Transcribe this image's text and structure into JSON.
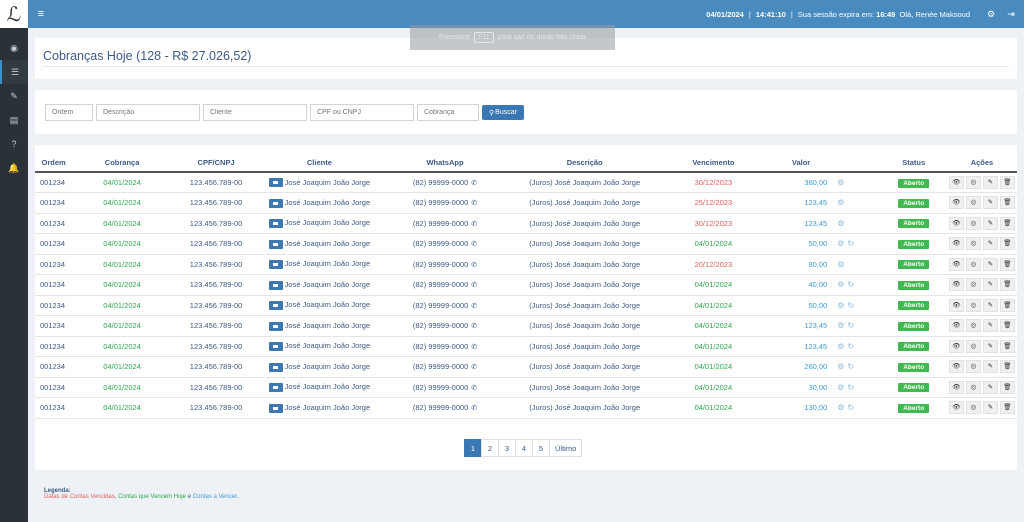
{
  "app": {
    "logo": "ℒ"
  },
  "sidebar": {
    "items": [
      {
        "name": "dashboard-icon",
        "glyph": "◉",
        "active": false
      },
      {
        "name": "list-icon",
        "glyph": "☰",
        "active": true
      },
      {
        "name": "edit-icon",
        "glyph": "✎",
        "active": false
      },
      {
        "name": "document-icon",
        "glyph": "▤",
        "active": false
      },
      {
        "name": "help-icon",
        "glyph": "?",
        "active": false
      },
      {
        "name": "bell-icon",
        "glyph": "🔔",
        "active": false
      }
    ]
  },
  "topbar": {
    "menu_glyph": "≡",
    "date": "04/01/2024",
    "divider": "|",
    "time": "14:41:10",
    "session_text": "Sua sessão expira em:",
    "session_time": "16:49",
    "greeting": "Olá, Renée Maksoud",
    "settings_glyph": "⚙",
    "logout_glyph": "⇥"
  },
  "fullscreen_toast": {
    "before": "Pressione",
    "key": "F11",
    "after": "para sair do modo tela cheia"
  },
  "page": {
    "title": "Cobranças Hoje (128 - R$ 27.026,52)"
  },
  "filters": {
    "ordem": "Ordem",
    "descricao": "Descrição",
    "cliente": "Cliente",
    "cpf": "CPF ou CNPJ",
    "cobranca": "Cobrança",
    "search_label": "Buscar"
  },
  "table": {
    "headers": [
      "Ordem",
      "Cobrança",
      "CPF/CNPJ",
      "Cliente",
      "WhatsApp",
      "Descrição",
      "Vencimento",
      "Valor",
      "",
      "Status",
      "Ações"
    ],
    "rows": [
      {
        "ordem": "001234",
        "cobranca": "04/01/2024",
        "cpf": "123.456.789-00",
        "cliente": "José Joaquim João Jorge",
        "whatsapp": "(82) 99999-0000",
        "descricao": "(Juros) José Joaquim João Jorge",
        "vencimento": "30/12/2023",
        "late": true,
        "valor": "380,00",
        "recurring": false,
        "status": "Aberto"
      },
      {
        "ordem": "001234",
        "cobranca": "04/01/2024",
        "cpf": "123.456.789-00",
        "cliente": "José Joaquim João Jorge",
        "whatsapp": "(82) 99999-0000",
        "descricao": "(Juros) José Joaquim João Jorge",
        "vencimento": "25/12/2023",
        "late": true,
        "valor": "123,45",
        "recurring": false,
        "status": "Aberto"
      },
      {
        "ordem": "001234",
        "cobranca": "04/01/2024",
        "cpf": "123.456.789-00",
        "cliente": "José Joaquim João Jorge",
        "whatsapp": "(82) 99999-0000",
        "descricao": "(Juros) José Joaquim João Jorge",
        "vencimento": "30/12/2023",
        "late": true,
        "valor": "123,45",
        "recurring": false,
        "status": "Aberto"
      },
      {
        "ordem": "001234",
        "cobranca": "04/01/2024",
        "cpf": "123.456.789-00",
        "cliente": "José Joaquim João Jorge",
        "whatsapp": "(82) 99999-0000",
        "descricao": "(Juros) José Joaquim João Jorge",
        "vencimento": "04/01/2024",
        "late": false,
        "valor": "50,00",
        "recurring": true,
        "status": "Aberto"
      },
      {
        "ordem": "001234",
        "cobranca": "04/01/2024",
        "cpf": "123.456.789-00",
        "cliente": "José Joaquim João Jorge",
        "whatsapp": "(82) 99999-0000",
        "descricao": "(Juros) José Joaquim João Jorge",
        "vencimento": "20/12/2023",
        "late": true,
        "valor": "80,00",
        "recurring": false,
        "status": "Aberto"
      },
      {
        "ordem": "001234",
        "cobranca": "04/01/2024",
        "cpf": "123.456.789-00",
        "cliente": "José Joaquim João Jorge",
        "whatsapp": "(82) 99999-0000",
        "descricao": "(Juros) José Joaquim João Jorge",
        "vencimento": "04/01/2024",
        "late": false,
        "valor": "40,00",
        "recurring": true,
        "status": "Aberto"
      },
      {
        "ordem": "001234",
        "cobranca": "04/01/2024",
        "cpf": "123.456.789-00",
        "cliente": "José Joaquim João Jorge",
        "whatsapp": "(82) 99999-0000",
        "descricao": "(Juros) José Joaquim João Jorge",
        "vencimento": "04/01/2024",
        "late": false,
        "valor": "50,00",
        "recurring": true,
        "status": "Aberto"
      },
      {
        "ordem": "001234",
        "cobranca": "04/01/2024",
        "cpf": "123.456.789-00",
        "cliente": "José Joaquim João Jorge",
        "whatsapp": "(82) 99999-0000",
        "descricao": "(Juros) José Joaquim João Jorge",
        "vencimento": "04/01/2024",
        "late": false,
        "valor": "123,45",
        "recurring": true,
        "status": "Aberto"
      },
      {
        "ordem": "001234",
        "cobranca": "04/01/2024",
        "cpf": "123.456.789-00",
        "cliente": "José Joaquim João Jorge",
        "whatsapp": "(82) 99999-0000",
        "descricao": "(Juros) José Joaquim João Jorge",
        "vencimento": "04/01/2024",
        "late": false,
        "valor": "123,45",
        "recurring": true,
        "status": "Aberto"
      },
      {
        "ordem": "001234",
        "cobranca": "04/01/2024",
        "cpf": "123.456.789-00",
        "cliente": "José Joaquim João Jorge",
        "whatsapp": "(82) 99999-0000",
        "descricao": "(Juros) José Joaquim João Jorge",
        "vencimento": "04/01/2024",
        "late": false,
        "valor": "260,00",
        "recurring": true,
        "status": "Aberto"
      },
      {
        "ordem": "001234",
        "cobranca": "04/01/2024",
        "cpf": "123.456.789-00",
        "cliente": "José Joaquim João Jorge",
        "whatsapp": "(82) 99999-0000",
        "descricao": "(Juros) José Joaquim João Jorge",
        "vencimento": "04/01/2024",
        "late": false,
        "valor": "30,00",
        "recurring": true,
        "status": "Aberto"
      },
      {
        "ordem": "001234",
        "cobranca": "04/01/2024",
        "cpf": "123.456.789-00",
        "cliente": "José Joaquim João Jorge",
        "whatsapp": "(82) 99999-0000",
        "descricao": "(Juros) José Joaquim João Jorge",
        "vencimento": "04/01/2024",
        "late": false,
        "valor": "130,00",
        "recurring": true,
        "status": "Aberto"
      }
    ]
  },
  "pagination": {
    "pages": [
      "1",
      "2",
      "3",
      "4",
      "5"
    ],
    "active": "1",
    "last_label": "Último"
  },
  "legend": {
    "title": "Legenda:",
    "late": "Datas de Contas Vencidas",
    "sep1": ", ",
    "today": "Contas que Vencem Hoje",
    "sep2": " e ",
    "future": "Contas a Vencer",
    "end": "."
  },
  "colors": {
    "topbar": "#4a8bbf",
    "sidebar": "#2b3138",
    "late": "#e0605d",
    "today": "#2fa84f",
    "future": "#3f9bd5",
    "status": "#3fb950"
  }
}
